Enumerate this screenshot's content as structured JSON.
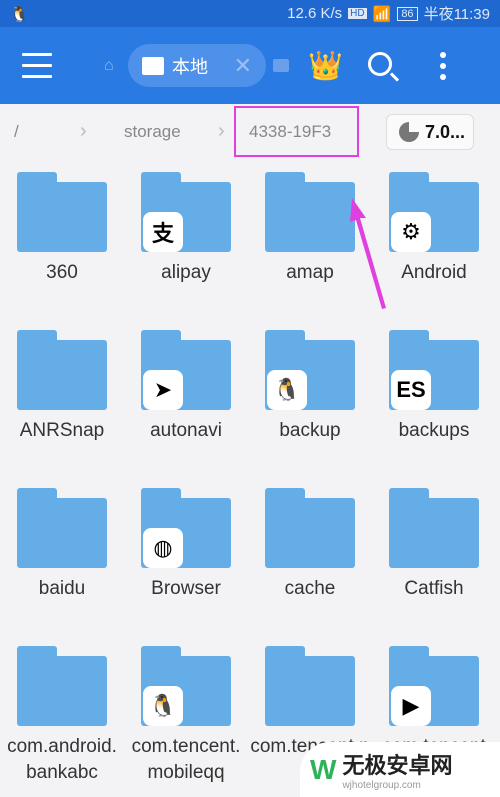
{
  "status": {
    "speed": "12.6 K/s",
    "hd": "HD",
    "network": "4G",
    "battery": "86",
    "time": "半夜11:39"
  },
  "appbar": {
    "tab_label": "本地",
    "close": "✕",
    "crown": "👑"
  },
  "breadcrumb": {
    "root": "/",
    "items": [
      "storage",
      "4338-19F3"
    ],
    "storage_usage": "7.0..."
  },
  "folders": [
    {
      "name": "360",
      "badge": ""
    },
    {
      "name": "alipay",
      "badge": "支"
    },
    {
      "name": "amap",
      "badge": ""
    },
    {
      "name": "Android",
      "badge": "⚙"
    },
    {
      "name": "ANRSnap",
      "badge": ""
    },
    {
      "name": "autonavi",
      "badge": "➤"
    },
    {
      "name": "backup",
      "badge": "🐧"
    },
    {
      "name": "backups",
      "badge": "ES"
    },
    {
      "name": "baidu",
      "badge": ""
    },
    {
      "name": "Browser",
      "badge": "◍"
    },
    {
      "name": "cache",
      "badge": ""
    },
    {
      "name": "Catfish",
      "badge": ""
    },
    {
      "name": "com.android.bankabc",
      "badge": ""
    },
    {
      "name": "com.tencent.mobileqq",
      "badge": "🐧"
    },
    {
      "name": "com.tencent.nt",
      "badge": ""
    },
    {
      "name": "com.tencent",
      "badge": "▶"
    }
  ],
  "watermark": {
    "title": "无极安卓网",
    "url": "wjhotelgroup.com"
  },
  "colors": {
    "appbar": "#2a7ae3",
    "folder": "#64ade6",
    "highlight": "#e040e0"
  }
}
